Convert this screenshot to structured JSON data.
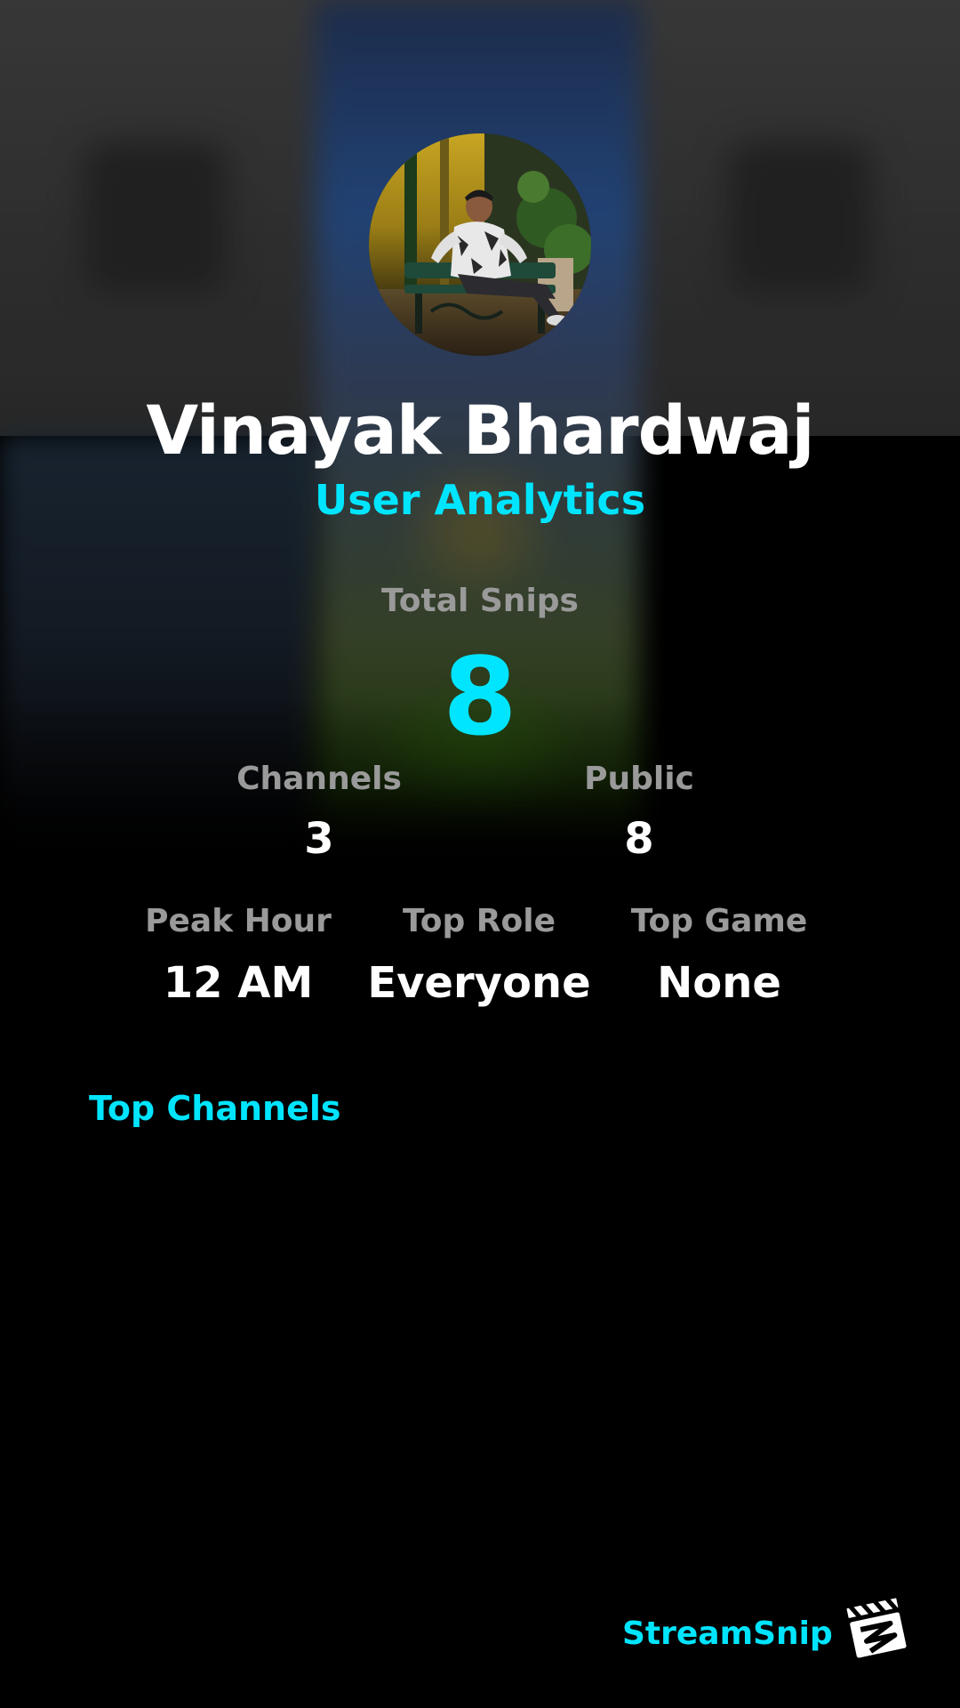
{
  "profile": {
    "name": "Vinayak Bhardwaj",
    "subtitle": "User Analytics",
    "avatar_description": "profile-photo"
  },
  "stats": {
    "total_snips_label": "Total Snips",
    "total_snips_value": "8",
    "channels_label": "Channels",
    "channels_value": "3",
    "public_label": "Public",
    "public_value": "8",
    "peak_hour_label": "Peak Hour",
    "peak_hour_value": "12 AM",
    "top_role_label": "Top Role",
    "top_role_value": "Everyone",
    "top_game_label": "Top Game",
    "top_game_value": "None"
  },
  "sections": {
    "top_channels_title": "Top Channels"
  },
  "branding": {
    "name": "StreamSnip",
    "logo_icon": "clapperboard-icon"
  },
  "colors": {
    "accent": "#00e5ff",
    "text": "#ffffff",
    "muted": "#9a9a9a",
    "background": "#000000"
  }
}
